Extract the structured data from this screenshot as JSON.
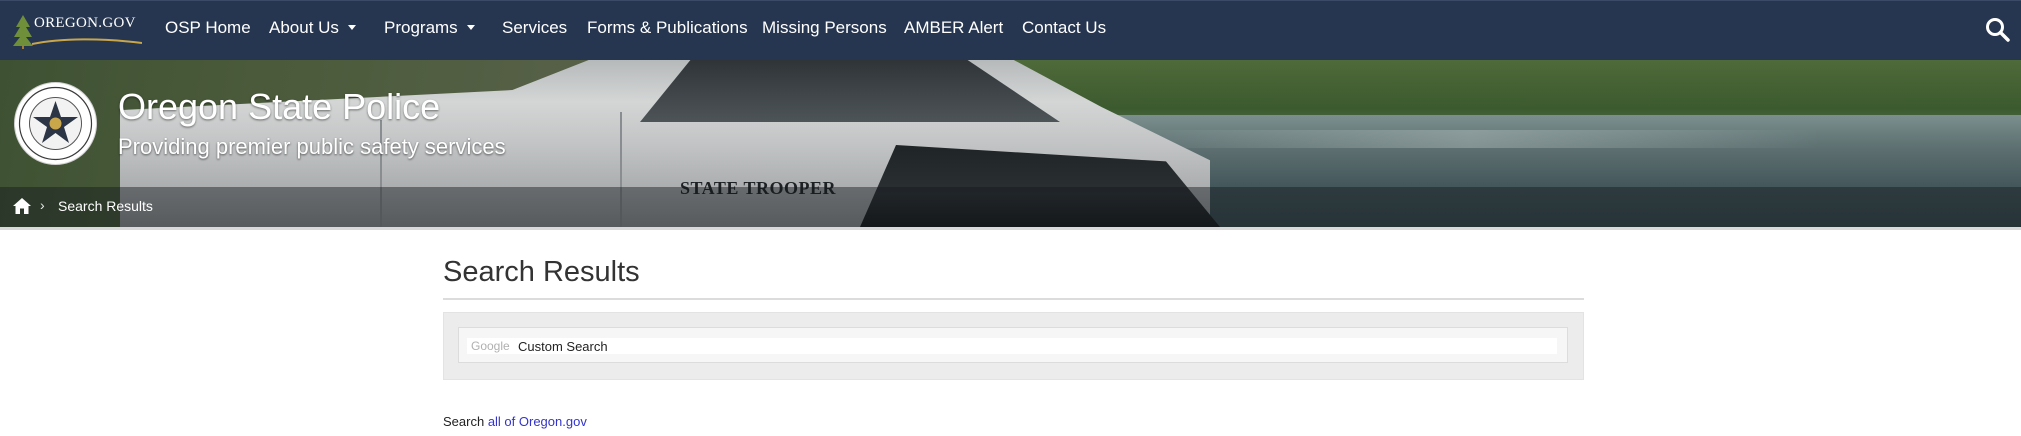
{
  "nav": {
    "logo_text": "OREGON.GOV",
    "items": [
      {
        "label": "OSP Home"
      },
      {
        "label": "About Us"
      },
      {
        "label": "Programs"
      },
      {
        "label": "Services"
      },
      {
        "label": "Forms & Publications"
      },
      {
        "label": "Missing Persons"
      },
      {
        "label": "AMBER Alert"
      },
      {
        "label": "Contact Us"
      }
    ],
    "search_icon": "search-icon"
  },
  "hero": {
    "title": "Oregon State Police",
    "subtitle": "Providing premier public safety services",
    "vehicle_text": "STATE TROOPER",
    "seal_icon": "oregon-state-police-seal"
  },
  "breadcrumb": {
    "home_icon": "home-icon",
    "separator": "›",
    "current": "Search Results"
  },
  "main": {
    "title": "Search Results",
    "search": {
      "brand": "Google",
      "placeholder": "Custom Search"
    },
    "search_all": {
      "prefix": "Search ",
      "link": "all of Oregon.gov"
    }
  },
  "colors": {
    "nav_bg": "#263650",
    "link": "#3333cc",
    "panel_bg": "#ececec"
  }
}
